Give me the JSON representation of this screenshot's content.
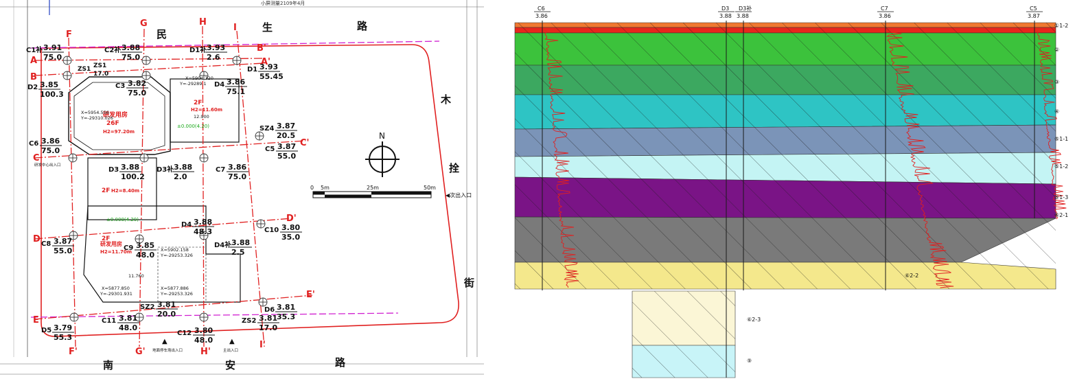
{
  "plan": {
    "roads": {
      "top": [
        "民",
        "生",
        "路"
      ],
      "bottom": [
        "南",
        "安",
        "路"
      ],
      "right": [
        "木",
        "拴",
        "街"
      ]
    },
    "top_note": "小屏测量2109年4月",
    "axes": {
      "A": "A",
      "A_prime": "A'",
      "B": "B",
      "B_prime": "B'",
      "C": "C",
      "C_prime": "C'",
      "D": "D",
      "D_prime": "D'",
      "E": "E",
      "E_prime": "E'",
      "F": "F",
      "F_prime": "F'",
      "G": "G",
      "G_prime": "G'",
      "H": "H",
      "H_prime": "H'",
      "I": "I",
      "I_prime": "I'"
    },
    "boreholes": [
      {
        "id": "C1补",
        "elev": "3.91",
        "depth": "75.0"
      },
      {
        "id": "C2补",
        "elev": "3.88",
        "depth": "75.0"
      },
      {
        "id": "D1补",
        "elev": "3.93",
        "depth": "2.6"
      },
      {
        "id": "D1",
        "elev": "3.93",
        "depth": "55.45"
      },
      {
        "id": "D2",
        "elev": "3.85",
        "depth": "100.3"
      },
      {
        "id": "C3",
        "elev": "3.82",
        "depth": "75.0"
      },
      {
        "id": "D4",
        "elev": "3.86",
        "depth": "75.1"
      },
      {
        "id": "SZ4",
        "elev": "3.87",
        "depth": "20.5"
      },
      {
        "id": "C5",
        "elev": "3.87",
        "depth": "55.0"
      },
      {
        "id": "C6",
        "elev": "3.86",
        "depth": "75.0"
      },
      {
        "id": "D3",
        "elev": "3.88",
        "depth": "100.2"
      },
      {
        "id": "D3补",
        "elev": "3.88",
        "depth": "2.0"
      },
      {
        "id": "C7",
        "elev": "3.86",
        "depth": "75.0"
      },
      {
        "id": "D4",
        "elev": "3.88",
        "depth": "48.3"
      },
      {
        "id": "C10",
        "elev": "3.80",
        "depth": "35.0"
      },
      {
        "id": "C8",
        "elev": "3.87",
        "depth": "55.0"
      },
      {
        "id": "C9",
        "elev": "3.85",
        "depth": "48.0"
      },
      {
        "id": "D4补",
        "elev": "3.88",
        "depth": "2.5"
      },
      {
        "id": "SZ2",
        "elev": "3.81",
        "depth": "20.0"
      },
      {
        "id": "D6",
        "elev": "3.81",
        "depth": "35.3"
      },
      {
        "id": "ZS2",
        "elev": "3.81",
        "depth": "17.0"
      },
      {
        "id": "C11",
        "elev": "3.81",
        "depth": "48.0"
      },
      {
        "id": "C12",
        "elev": "3.80",
        "depth": "48.0"
      },
      {
        "id": "D5",
        "elev": "3.79",
        "depth": "55.3"
      }
    ],
    "labels": {
      "zs1": "ZS1",
      "zs1b": "ZS1",
      "zs1_depth": "17.0",
      "bldg1_name": "研发用房",
      "bldg1_floors": "26F",
      "bldg1_height": "H2=97.20m",
      "bldg1_coord_x": "X=5954.556",
      "bldg1_coord_y": "Y=-29310.026",
      "bldg2_floors": "2F",
      "bldg2_height": "H2=11.60m",
      "bldg2_elev": "±0.000(4.20)",
      "bldg2_dim": "12.900",
      "bldg3_floors": "2F",
      "bldg3_height": "H2=8.40m",
      "bldg4_elev": "±0.000(4.20)",
      "bldg4_floors": "2F",
      "bldg4_name": "研发用房",
      "bldg4_height": "H2=11.70m",
      "coord1_x": "X=5904.320",
      "coord1_y": "Y=-29289.1",
      "coord2_x": "X=5902.158",
      "coord2_y": "Y=-29253.326",
      "coord3_x": "X=5877.850",
      "coord3_y": "Y=-29301.931",
      "coord4_x": "X=5877.886",
      "coord4_y": "Y=-29253.326",
      "dim_11760": "11.760",
      "north": "N",
      "exit_right": "◀次出入口",
      "exit_bottom1": "▲",
      "exit_bottom2": "▲",
      "exit_bottom1_label": "地面停车场出入口",
      "exit_bottom2_label": "主出入口",
      "exit_left": "研发中心出入口",
      "scale_0": "0",
      "scale_5": "5m",
      "scale_25": "25m",
      "scale_50": "50m"
    }
  },
  "section": {
    "top_labels": [
      {
        "id": "C6",
        "elev": "3.86"
      },
      {
        "id": "D3",
        "elev": "3.88"
      },
      {
        "id": "D3补",
        "elev": "3.88"
      },
      {
        "id": "C7",
        "elev": "3.86"
      },
      {
        "id": "C5",
        "elev": "3.87"
      }
    ],
    "layer_labels": [
      "①1-2",
      "②",
      "③",
      "④",
      "⑤1-1",
      "⑤1-2",
      "⑤1-3",
      "⑥2-1",
      "⑥2-2",
      "⑥2-3",
      "⑨"
    ],
    "layer_colors": {
      "fill": "#f07830",
      "red": "#e8261c",
      "green": "#3cc23c",
      "dark_green": "#3ca860",
      "cyan": "#2ec4c4",
      "steel": "#7b94b8",
      "light_cyan": "#c4f4f4",
      "purple": "#7a1486",
      "gray": "#7a7a7a",
      "sand": "#f4e88c",
      "pale_sand": "#fbf6d6",
      "pale_cyan": "#c8f4f8"
    }
  }
}
